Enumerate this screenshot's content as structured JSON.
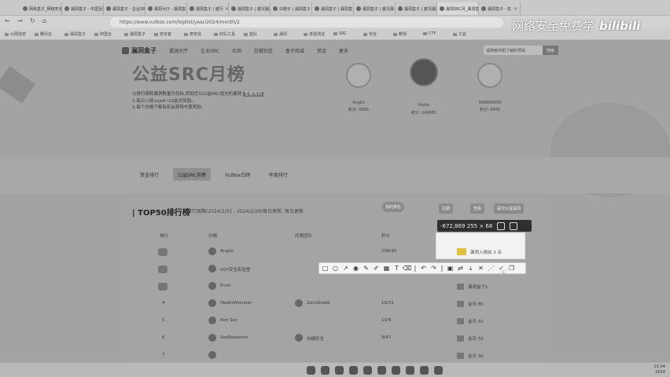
{
  "browser": {
    "tabs": [
      {
        "label": "网易盒子_网络安全"
      },
      {
        "label": "漏洞盒子 - 中国互联"
      },
      {
        "label": "漏洞盒子 - 企业SRC"
      },
      {
        "label": "漏洞大厅 - 漏洞盒子"
      },
      {
        "label": "漏洞盒子 | 盛行"
      },
      {
        "label": "漏洞盒子 | 盛况漏洞"
      },
      {
        "label": "白帽子 | 漏洞盒子"
      },
      {
        "label": "漏洞盒子 | 漏洞盒"
      },
      {
        "label": "漏洞盒子 | 盛况漏"
      },
      {
        "label": "漏洞盒子 | 盛况漏洞"
      },
      {
        "label": "漏洞SRC月_漏洞盒"
      },
      {
        "label": "漏洞盒子 - 实"
      }
    ],
    "url": "https://www.vulbox.com/toplist/year/2024/month/2",
    "bookmarks": [
      "公网信安",
      "腾讯云",
      "漏洞盒子",
      "阿里云",
      "漏洞盒子",
      "安全客",
      "奇安信",
      "红队工具",
      "蓝队",
      "漏洞",
      "渗透测试",
      "SRC",
      "安全",
      "靶场",
      "CTF",
      "工具"
    ]
  },
  "site": {
    "logo": "漏洞盒子",
    "nav": [
      "漏洞大厅",
      "企业SRC",
      "众测",
      "白帽社区",
      "盒子商城",
      "赏金",
      "更多"
    ],
    "search_placeholder": "请搜索你想了解的项目",
    "search_button": "搜索",
    "hero_title": "公益SRC月榜",
    "hero_lines": [
      "以排行榜和漏洞数量为目标,奖励您以公益SRC提交的漏洞",
      "1.每日入榜,top4~10金币奖励。",
      "2.每个白帽子都有机会获得丰厚奖励。"
    ],
    "hero_highlight": "查看规则",
    "top3": [
      {
        "name": "Anglio",
        "score": "积分: 6666"
      },
      {
        "name": "Alpha",
        "score": "积分: 149681"
      },
      {
        "name": "999999999",
        "score": "积分: 6666"
      }
    ],
    "band_tabs": [
      "赏金排行",
      "公益SRC月榜",
      "VulBox白榜",
      "年度排行"
    ],
    "section_title": "TOP50排行榜",
    "section_sub": "排行周期(2024/2/01 - 2024/2/29)每日更新, 每日更新",
    "buttons": [
      "我的排名",
      "往期",
      "查看",
      "提交公益漏洞"
    ],
    "table_headers": [
      "排行",
      "白帽",
      "所属团队",
      "积分",
      "奖励"
    ],
    "rows": [
      {
        "rank": "1",
        "name": "Anglio",
        "team": "",
        "score": "206/95",
        "reward": ""
      },
      {
        "rank": "2",
        "name": "0UY安全实验室",
        "team": "",
        "score": "",
        "reward": ""
      },
      {
        "rank": "3",
        "name": "Enzo",
        "team": "",
        "score": "",
        "reward": "漏洞盒子1"
      },
      {
        "rank": "4",
        "name": "HealthMonster",
        "team": "ZeroShield",
        "score": "10/31",
        "reward": "金币 80"
      },
      {
        "rank": "5",
        "name": "Peri Sec",
        "team": "",
        "score": "10/9",
        "reward": "金币 50"
      },
      {
        "rank": "6",
        "name": "SecResearch",
        "team": "白帽安全",
        "score": "9/47",
        "reward": "金币 50"
      },
      {
        "rank": "7",
        "name": "",
        "team": "",
        "score": "",
        "reward": "金币 30"
      }
    ]
  },
  "overlay": {
    "size_readout": "-672,869  255 × 68",
    "selection_text": "漏洞入榜前 3 名",
    "tools": [
      "rect",
      "ellipse",
      "arrow",
      "pen",
      "mosaic",
      "marker",
      "text",
      "eraser",
      "undo",
      "redo",
      "pin",
      "save",
      "close",
      "ocr",
      "copy"
    ]
  },
  "watermark": {
    "text": "网络安全免费学",
    "brand": "bilibili"
  },
  "taskbar": {
    "time": "21:04",
    "date": "2024"
  }
}
